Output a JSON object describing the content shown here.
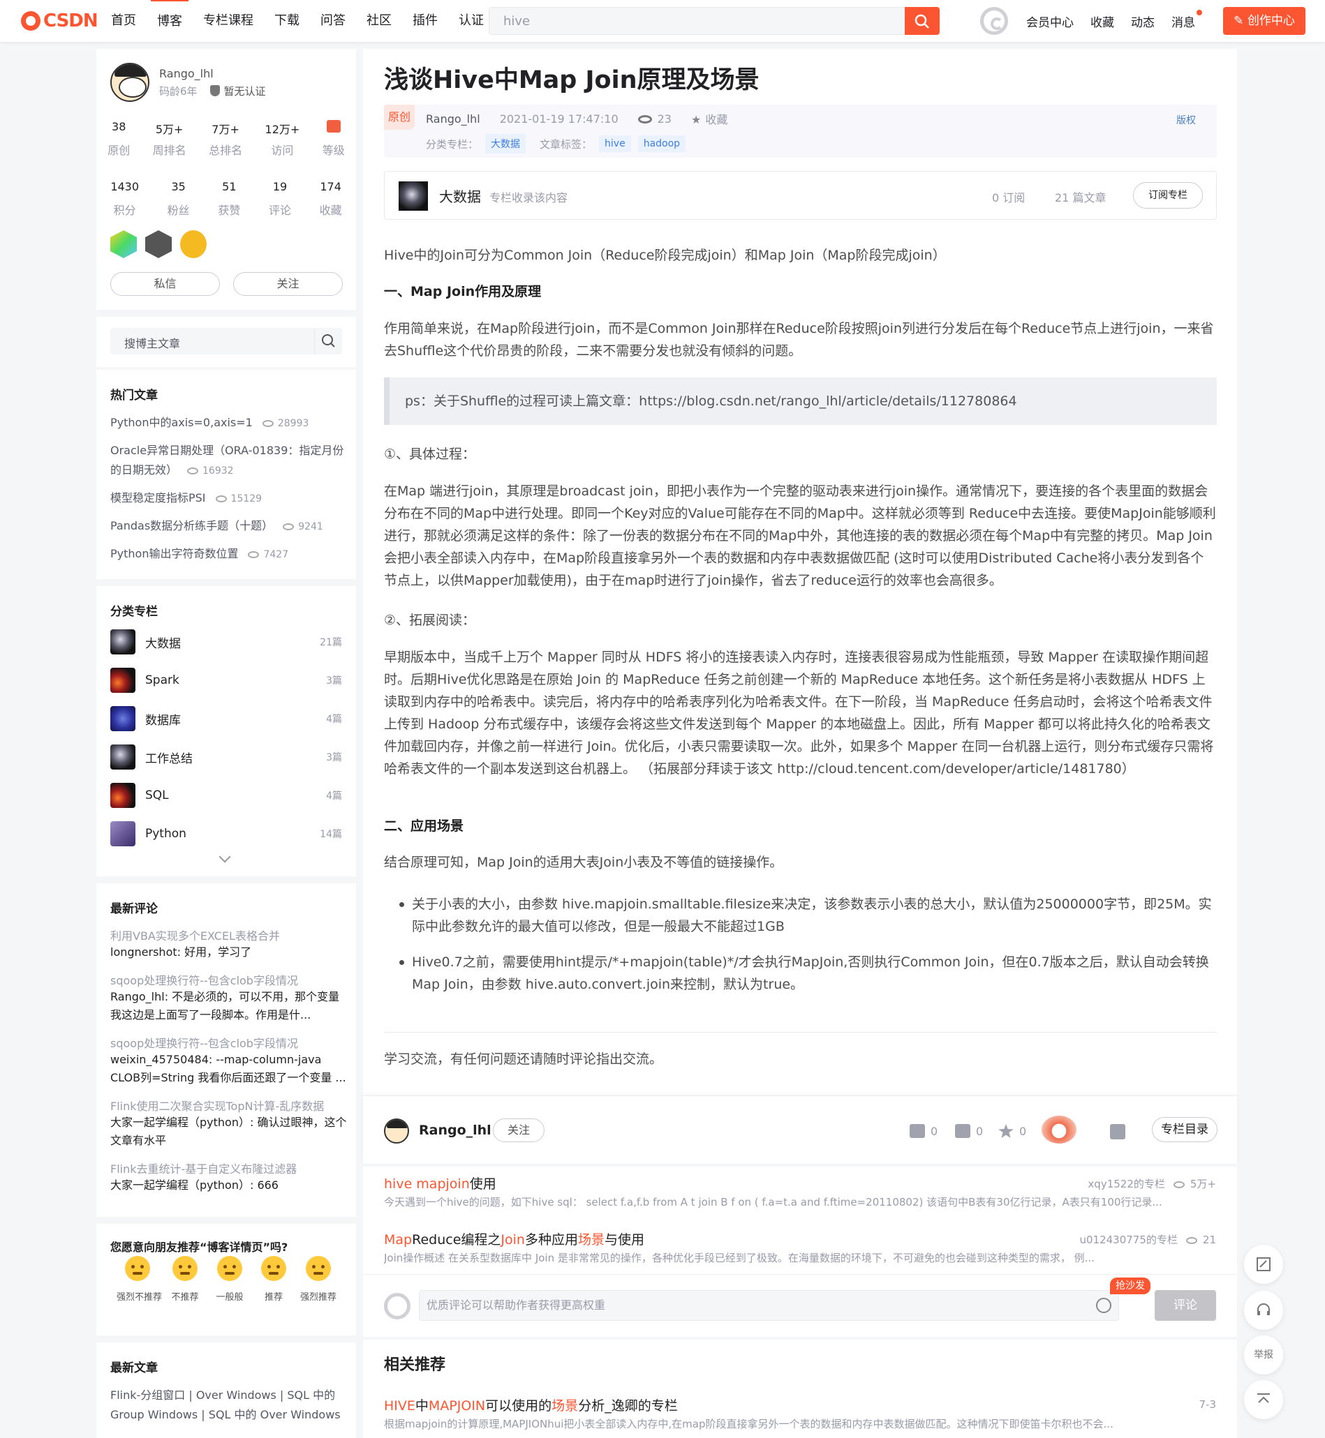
{
  "topbar": {
    "logo": "CSDN",
    "nav": [
      "首页",
      "博客",
      "专栏课程",
      "下载",
      "问答",
      "社区",
      "插件",
      "认证"
    ],
    "search_value": "hive",
    "right": [
      "会员中心",
      "收藏",
      "动态",
      "消息"
    ],
    "create": "创作中心"
  },
  "profile": {
    "name": "Rango_lhl",
    "age": "码龄6年",
    "verify": "暂无认证",
    "stats1": [
      {
        "n": "38",
        "l": "原创"
      },
      {
        "n": "5万+",
        "l": "周排名"
      },
      {
        "n": "7万+",
        "l": "总排名"
      },
      {
        "n": "12万+",
        "l": "访问"
      },
      {
        "n": "",
        "l": "等级"
      }
    ],
    "stats2": [
      {
        "n": "1430",
        "l": "积分"
      },
      {
        "n": "35",
        "l": "粉丝"
      },
      {
        "n": "51",
        "l": "获赞"
      },
      {
        "n": "19",
        "l": "评论"
      },
      {
        "n": "174",
        "l": "收藏"
      }
    ],
    "btn_msg": "私信",
    "btn_follow": "关注"
  },
  "side_search": {
    "placeholder": "搜博主文章"
  },
  "hot": {
    "title": "热门文章",
    "items": [
      {
        "t": "Python中的axis=0,axis=1",
        "c": "28993"
      },
      {
        "t": "Oracle异常日期处理（ORA-01839：指定月份的日期无效）",
        "c": "16932"
      },
      {
        "t": "模型稳定度指标PSI",
        "c": "15129"
      },
      {
        "t": "Pandas数据分析练手题（十题）",
        "c": "9241"
      },
      {
        "t": "Python输出字符奇数位置",
        "c": "7427"
      }
    ]
  },
  "cats": {
    "title": "分类专栏",
    "items": [
      {
        "n": "大数据",
        "c": "21篇"
      },
      {
        "n": "Spark",
        "c": "3篇"
      },
      {
        "n": "数据库",
        "c": "4篇"
      },
      {
        "n": "工作总结",
        "c": "3篇"
      },
      {
        "n": "SQL",
        "c": "4篇"
      },
      {
        "n": "Python",
        "c": "14篇"
      }
    ]
  },
  "comments": {
    "title": "最新评论",
    "items": [
      {
        "a": "利用VBA实现多个EXCEL表格合并",
        "t": "longnershot: 好用，学习了"
      },
      {
        "a": "sqoop处理换行符--包含clob字段情况",
        "t": "Rango_lhl: 不是必须的，可以不用，那个变量我这边是上面写了一段脚本。作用是什..."
      },
      {
        "a": "sqoop处理换行符--包含clob字段情况",
        "t": "weixin_45750484: --map-column-java CLOB列=String 我看你后面还跟了一个变量 ..."
      },
      {
        "a": "Flink使用二次聚合实现TopN计算-乱序数据",
        "t": "大家一起学编程（python）: 确认过眼神，这个文章有水平"
      },
      {
        "a": "Flink去重统计-基于自定义布隆过滤器",
        "t": "大家一起学编程（python）: 666"
      }
    ]
  },
  "survey": {
    "title": "您愿意向朋友推荐“博客详情页”吗?",
    "opts": [
      "强烈不推荐",
      "不推荐",
      "一般般",
      "推荐",
      "强烈推荐"
    ]
  },
  "latest": {
    "title": "最新文章",
    "first": "Flink-分组窗口 | Over Windows | SQL 中的 Group Windows | SQL 中的 Over Windows"
  },
  "article": {
    "title": "浅谈Hive中Map Join原理及场景",
    "orig": "原创",
    "author": "Rango_lhl",
    "date": "2021-01-19 17:47:10",
    "views": "23",
    "fav": "收藏",
    "copyright": "版权",
    "cat_label": "分类专栏：",
    "cat": "大数据",
    "tag_label": "文章标签：",
    "tags": [
      "hive",
      "hadoop"
    ],
    "column": {
      "name": "大数据",
      "desc": "专栏收录该内容",
      "subs": "0 订阅",
      "count": "21 篇文章",
      "btn": "订阅专栏"
    },
    "p1": "Hive中的Join可分为Common Join（Reduce阶段完成join）和Map Join（Map阶段完成join）",
    "h1": "一、Map Join作用及原理",
    "p2": "作用简单来说，在Map阶段进行join，而不是Common Join那样在Reduce阶段按照join列进行分发后在每个Reduce节点上进行join，一来省去Shuffle这个代价昂贵的阶段，二来不需要分发也就没有倾斜的问题。",
    "quote": "ps：关于Shuffle的过程可读上篇文章：https://blog.csdn.net/rango_lhl/article/details/112780864",
    "s1": "①、具体过程：",
    "p3": "在Map 端进行join，其原理是broadcast join，即把小表作为一个完整的驱动表来进行join操作。通常情况下，要连接的各个表里面的数据会分布在不同的Map中进行处理。即同一个Key对应的Value可能存在不同的Map中。这样就必须等到 Reduce中去连接。要使MapJoin能够顺利进行，那就必须满足这样的条件：除了一份表的数据分布在不同的Map中外，其他连接的表的数据必须在每个Map中有完整的拷贝。Map Join会把小表全部读入内存中，在Map阶段直接拿另外一个表的数据和内存中表数据做匹配 (这时可以使用Distributed Cache将小表分发到各个节点上，以供Mapper加载使用)，由于在map时进行了join操作，省去了reduce运行的效率也会高很多。",
    "s2": "②、拓展阅读：",
    "p4": "早期版本中，当成千上万个 Mapper 同时从 HDFS 将小的连接表读入内存时，连接表很容易成为性能瓶颈，导致 Mapper 在读取操作期间超时。后期Hive优化思路是在原始 Join 的 MapReduce 任务之前创建一个新的 MapReduce 本地任务。这个新任务是将小表数据从 HDFS 上读取到内存中的哈希表中。读完后，将内存中的哈希表序列化为哈希表文件。在下一阶段，当 MapReduce 任务启动时，会将这个哈希表文件上传到 Hadoop 分布式缓存中，该缓存会将这些文件发送到每个 Mapper 的本地磁盘上。因此，所有 Mapper 都可以将此持久化的哈希表文件加载回内存，并像之前一样进行 Join。优化后，小表只需要读取一次。此外，如果多个 Mapper 在同一台机器上运行，则分布式缓存只需将哈希表文件的一个副本发送到这台机器上。 （拓展部分拜读于该文 http://cloud.tencent.com/developer/article/1481780）",
    "h2": "二、应用场景",
    "p5": "结合原理可知，Map Join的适用大表Join小表及不等值的链接操作。",
    "b1": "关于小表的大小，由参数 hive.mapjoin.smalltable.filesize来决定，该参数表示小表的总大小，默认值为25000000字节，即25M。实际中此参数允许的最大值可以修改，但是一般最大不能超过1GB",
    "b2": "Hive0.7之前，需要使用hint提示/*+mapjoin(table)*/才会执行MapJoin,否则执行Common Join，但在0.7版本之后，默认自动会转换Map Join，由参数 hive.auto.convert.join来控制，默认为true。",
    "p6": "学习交流，有任何问题还请随时评论指出交流。"
  },
  "toolbar": {
    "name": "Rango_lhl",
    "follow": "关注",
    "likes": "0",
    "comments": "0",
    "stars": "0",
    "dir": "专栏目录"
  },
  "recs": [
    {
      "t1": "hive mapjoin",
      "t2": "使用",
      "src": "xqy1522的专栏",
      "views": "5万+",
      "d": "今天遇到一个hive的问题，如下hive sql：  select f.a,f.b from A t join B f  on ( f.a=t.a and f.ftime=20110802)  该语句中B表有30亿行记录，A表只有100行记录..."
    },
    {
      "t1": "MapReduce编程之Join多种应用场景与使用",
      "src": "u012430775的专栏",
      "views": "21",
      "d": "Join操作概述 在关系型数据库中 Join 是非常常见的操作，各种优化手段已经到了极致。在海量数据的环境下，不可避免的也会碰到这种类型的需求， 例..."
    }
  ],
  "commentbar": {
    "placeholder": "优质评论可以帮助作者获得更高权重",
    "tag": "抢沙发",
    "btn": "评论"
  },
  "related": {
    "title": "相关推荐",
    "item": {
      "t": "HIVE中MAPJOIN可以使用的场景分析_逸卿的专栏",
      "date": "7-3",
      "d": "根据mapjoin的计算原理,MAPJIONhui把小表全部读入内存中,在map阶段直接拿另外一个表的数据和内存中表数据做匹配。这种情况下即使笛卡尔积也不会..."
    }
  },
  "float": {
    "report": "举报"
  }
}
